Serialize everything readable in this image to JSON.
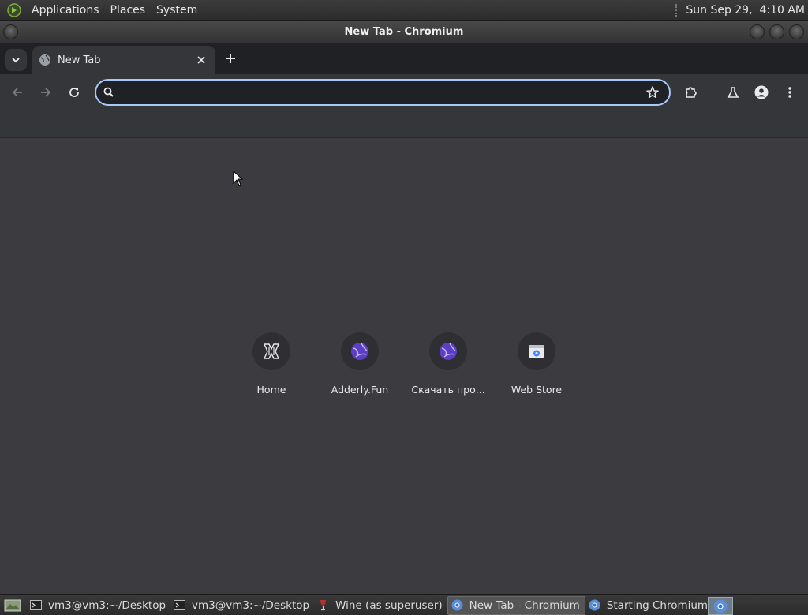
{
  "top_panel": {
    "menus": [
      "Applications",
      "Places",
      "System"
    ],
    "clock": "Sun Sep 29,  4:10 AM"
  },
  "window": {
    "title": "New Tab - Chromium"
  },
  "tabs": [
    {
      "title": "New Tab"
    }
  ],
  "omnibox": {
    "value": "",
    "placeholder": ""
  },
  "shortcuts": [
    {
      "label": "Home",
      "icon": "home-shortcut-icon"
    },
    {
      "label": "Adderly.Fun",
      "icon": "globe-icon"
    },
    {
      "label": "Скачать про...",
      "icon": "globe-icon"
    },
    {
      "label": "Web Store",
      "icon": "web-store-icon"
    }
  ],
  "taskbar": {
    "items": [
      {
        "label": "vm3@vm3:~/Desktop",
        "icon": "terminal-icon"
      },
      {
        "label": "vm3@vm3:~/Desktop",
        "icon": "terminal-icon"
      },
      {
        "label": "Wine (as superuser)",
        "icon": "wine-icon"
      },
      {
        "label": "New Tab - Chromium",
        "icon": "chromium-icon",
        "active": true
      },
      {
        "label": "Starting Chromium",
        "icon": "chromium-icon"
      }
    ]
  },
  "colors": {
    "accent_focus": "#a8c7fa",
    "content_bg": "#3c3b40",
    "toolbar_bg": "#35363a",
    "tabstrip_bg": "#202124"
  }
}
